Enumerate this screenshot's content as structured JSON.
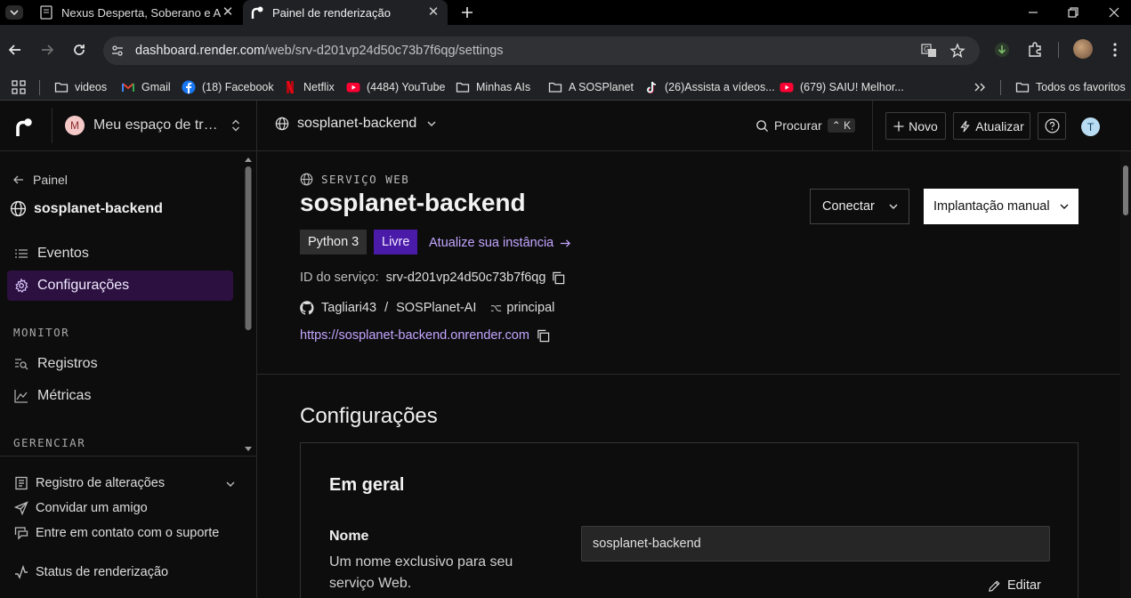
{
  "browser": {
    "tabs": [
      {
        "title": "Nexus Desperta, Soberano e Au"
      },
      {
        "title": "Painel de renderização"
      }
    ],
    "address": {
      "host": "dashboard.render.com",
      "path": "/web/srv-d201vp24d50c73b7f6qg/settings"
    },
    "bookmarks": [
      {
        "label": "videos",
        "icon": "folder-icon"
      },
      {
        "label": "Gmail",
        "icon": "gmail-icon"
      },
      {
        "label": "(18) Facebook",
        "icon": "facebook-icon"
      },
      {
        "label": "Netflix",
        "icon": "netflix-icon"
      },
      {
        "label": "(4484) YouTube",
        "icon": "youtube-icon"
      },
      {
        "label": "Minhas AIs",
        "icon": "folder-icon"
      },
      {
        "label": "A SOSPlanet",
        "icon": "folder-icon"
      },
      {
        "label": "(26)Assista a vídeos...",
        "icon": "tiktok-icon"
      },
      {
        "label": "(679) SAIU! Melhor...",
        "icon": "youtube-icon"
      }
    ],
    "all_bookmarks": "Todos os favoritos",
    "colors": {
      "youtube": "#ff0033",
      "facebook": "#1877f2",
      "netflix": "#e50914"
    }
  },
  "sidebar": {
    "workspace": {
      "initial": "M",
      "name": "Meu espaço de trabalho"
    },
    "back": "Painel",
    "service": "sosplanet-backend",
    "nav": [
      {
        "label": "Eventos",
        "icon": "list-icon"
      },
      {
        "label": "Configurações",
        "icon": "gear-icon",
        "active": true
      }
    ],
    "monitor_heading": "MONITOR",
    "monitor": [
      {
        "label": "Registros",
        "icon": "logs-icon"
      },
      {
        "label": "Métricas",
        "icon": "metrics-icon"
      }
    ],
    "manage_heading": "GERENCIAR",
    "bottom": [
      {
        "label": "Registro de alterações",
        "icon": "changelog-icon"
      },
      {
        "label": "Convidar um amigo",
        "icon": "send-icon"
      },
      {
        "label": "Entre em contato com o suporte",
        "icon": "support-icon"
      },
      {
        "label": "Status de renderização",
        "icon": "status-icon"
      }
    ]
  },
  "header": {
    "service": "sosplanet-backend",
    "search": "Procurar",
    "shortcut": "K",
    "new": "Novo",
    "upgrade": "Atualizar",
    "user_initial": "T"
  },
  "service": {
    "kind": "SERVIÇO WEB",
    "name": "sosplanet-backend",
    "connect": "Conectar",
    "deploy": "Implantação manual",
    "runtime": "Python 3",
    "plan": "Livre",
    "upgrade_link": "Atualize sua instância",
    "id_label": "ID do serviço:",
    "id": "srv-d201vp24d50c73b7f6qg",
    "repo_owner": "Tagliari43",
    "repo_sep": "/",
    "repo_name": "SOSPlanet-AI",
    "branch": "principal",
    "url": "https://sosplanet-backend.onrender.com"
  },
  "settings": {
    "heading": "Configurações",
    "general": "Em geral",
    "name_label": "Nome",
    "name_desc": "Um nome exclusivo para seu serviço Web.",
    "name_value": "sosplanet-backend",
    "edit": "Editar"
  },
  "accent": "#4a1aa8"
}
